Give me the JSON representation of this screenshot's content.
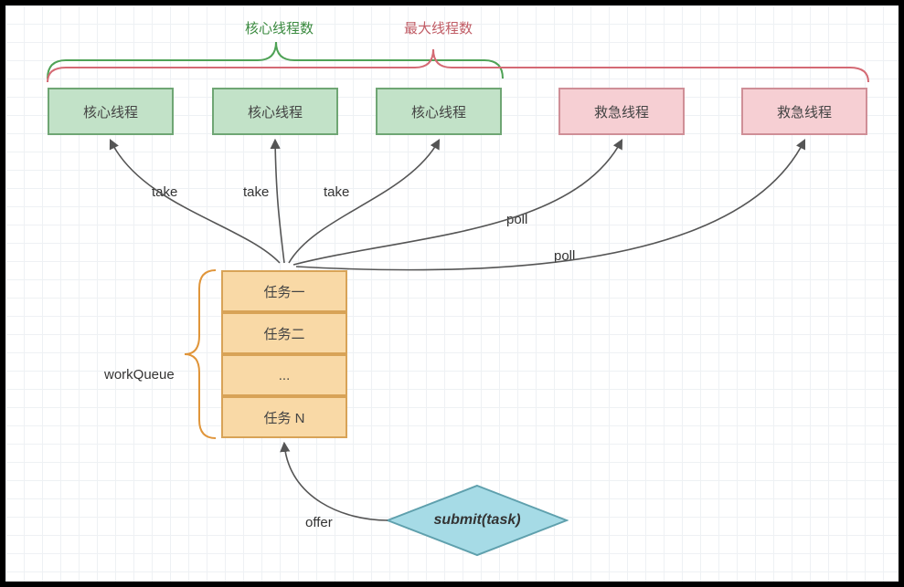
{
  "labels": {
    "corePoolSize": "核心线程数",
    "maxPoolSize": "最大线程数",
    "workQueue": "workQueue",
    "offer": "offer",
    "take1": "take",
    "take2": "take",
    "take3": "take",
    "poll1": "poll",
    "poll2": "poll",
    "submit": "submit(task)"
  },
  "threads": {
    "core1": "核心线程",
    "core2": "核心线程",
    "core3": "核心线程",
    "emerg1": "救急线程",
    "emerg2": "救急线程"
  },
  "queue": {
    "task1": "任务一",
    "task2": "任务二",
    "task3": "...",
    "task4": "任务 N"
  },
  "chart_data": {
    "type": "diagram",
    "description": "Java ThreadPoolExecutor structure",
    "groups": [
      {
        "name": "核心线程数",
        "members": [
          "核心线程",
          "核心线程",
          "核心线程"
        ],
        "queue_op": "take"
      },
      {
        "name": "最大线程数",
        "members": [
          "核心线程",
          "核心线程",
          "核心线程",
          "救急线程",
          "救急线程"
        ],
        "queue_op_extra": "poll"
      }
    ],
    "workQueue": [
      "任务一",
      "任务二",
      "...",
      "任务 N"
    ],
    "flows": [
      {
        "from": "submit(task)",
        "to": "workQueue",
        "op": "offer"
      },
      {
        "from": "workQueue",
        "to": "核心线程",
        "op": "take"
      },
      {
        "from": "workQueue",
        "to": "救急线程",
        "op": "poll"
      }
    ]
  }
}
